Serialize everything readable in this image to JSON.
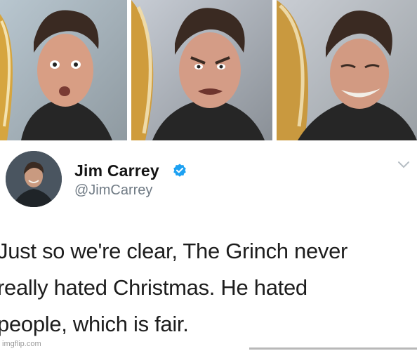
{
  "photos": {
    "panel_1": "surprised-face-photo",
    "panel_2": "grimacing-face-photo",
    "panel_3": "grinning-face-photo"
  },
  "tweet": {
    "display_name": "Jim Carrey",
    "handle": "@JimCarrey",
    "verified": true,
    "text_lines": [
      "Just so we're clear, The Grinch never",
      "really hated Christmas. He hated",
      "people, which is fair."
    ]
  },
  "watermark": "imgflip.com",
  "colors": {
    "verified_blue": "#1da1f2",
    "text": "#1d1d1d",
    "handle_gray": "#6f7a84"
  }
}
